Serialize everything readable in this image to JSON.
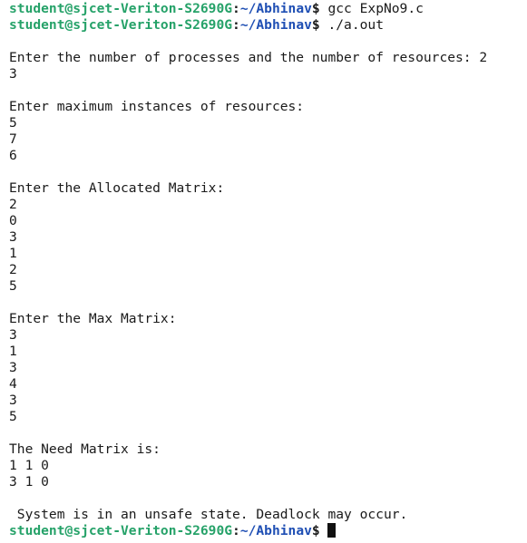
{
  "colors": {
    "background": "#ffffff",
    "text": "#1a1a1a",
    "prompt_user_host": "#26a269",
    "prompt_path": "#1f4fb4",
    "cursor": "#111111"
  },
  "prompt": {
    "user_host": "student@sjcet-Veriton-S2690G",
    "colon": ":",
    "path": "~/Abhinav",
    "symbol": "$"
  },
  "terminal": {
    "lines": [
      {
        "kind": "prompt",
        "command": " gcc ExpNo9.c"
      },
      {
        "kind": "prompt",
        "command": " ./a.out"
      },
      {
        "kind": "output",
        "text": ""
      },
      {
        "kind": "output",
        "text": "Enter the number of processes and the number of resources: 2"
      },
      {
        "kind": "output",
        "text": "3"
      },
      {
        "kind": "output",
        "text": ""
      },
      {
        "kind": "output",
        "text": "Enter maximum instances of resources:"
      },
      {
        "kind": "output",
        "text": "5"
      },
      {
        "kind": "output",
        "text": "7"
      },
      {
        "kind": "output",
        "text": "6"
      },
      {
        "kind": "output",
        "text": ""
      },
      {
        "kind": "output",
        "text": "Enter the Allocated Matrix:"
      },
      {
        "kind": "output",
        "text": "2"
      },
      {
        "kind": "output",
        "text": "0"
      },
      {
        "kind": "output",
        "text": "3"
      },
      {
        "kind": "output",
        "text": "1"
      },
      {
        "kind": "output",
        "text": "2"
      },
      {
        "kind": "output",
        "text": "5"
      },
      {
        "kind": "output",
        "text": ""
      },
      {
        "kind": "output",
        "text": "Enter the Max Matrix:"
      },
      {
        "kind": "output",
        "text": "3"
      },
      {
        "kind": "output",
        "text": "1"
      },
      {
        "kind": "output",
        "text": "3"
      },
      {
        "kind": "output",
        "text": "4"
      },
      {
        "kind": "output",
        "text": "3"
      },
      {
        "kind": "output",
        "text": "5"
      },
      {
        "kind": "output",
        "text": ""
      },
      {
        "kind": "output",
        "text": "The Need Matrix is:"
      },
      {
        "kind": "output",
        "text": "1 1 0"
      },
      {
        "kind": "output",
        "text": "3 1 0"
      },
      {
        "kind": "output",
        "text": ""
      },
      {
        "kind": "output",
        "text": " System is in an unsafe state. Deadlock may occur."
      },
      {
        "kind": "prompt",
        "command": " ",
        "cursor": true
      }
    ]
  }
}
